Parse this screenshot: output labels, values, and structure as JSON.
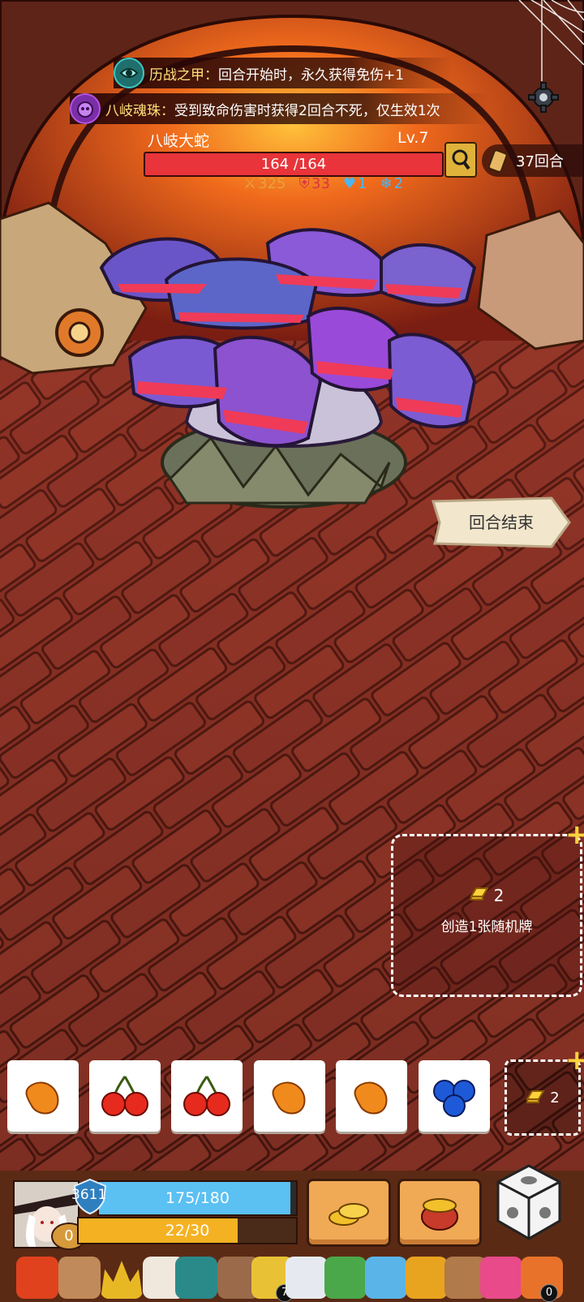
{
  "buffs": [
    {
      "name": "历战之甲：",
      "desc": "回合开始时，永久获得免伤+1",
      "icon": "armor-eye-icon",
      "color": "#3fc7c2"
    },
    {
      "name": "八岐魂珠：",
      "desc": "受到致命伤害时获得2回合不死，仅生效1次",
      "icon": "soul-orb-icon",
      "color": "#b454e0"
    }
  ],
  "boss": {
    "name": "八岐大蛇",
    "level": "Lv.7",
    "hp_text": "164 /164",
    "hp_fraction": 1.0
  },
  "boss_stats": [
    {
      "icon": "attack-icon",
      "value": "325",
      "color": "#e9a13a"
    },
    {
      "icon": "shield-icon",
      "value": "33",
      "color": "#d9363e"
    },
    {
      "icon": "heart-icon",
      "value": "1",
      "color": "#4bb6f0"
    },
    {
      "icon": "snowflake-icon",
      "value": "2",
      "color": "#4bb6f0"
    }
  ],
  "turn": {
    "label": "37回合",
    "icon": "scroll-icon"
  },
  "end_turn": "回合结束",
  "create_card": {
    "cost": "2",
    "label": "创造1张随机牌"
  },
  "hand": [
    {
      "icon": "mango-icon"
    },
    {
      "icon": "cherry-icon"
    },
    {
      "icon": "cherry-icon"
    },
    {
      "icon": "mango-icon"
    },
    {
      "icon": "mango-icon"
    },
    {
      "icon": "blueberry-icon"
    }
  ],
  "small_create_cost": "2",
  "player": {
    "armor": "3611",
    "hp_text": "175/180",
    "hp_fraction": 0.972,
    "energy_text": "22/30",
    "energy_fraction": 0.733,
    "gold": "0"
  },
  "relic_badges": {
    "r7": "7",
    "r14": "0"
  },
  "colors": {
    "hp_blue": "#5bc0f2",
    "boss_red": "#e8343a",
    "energy": "#f4b223",
    "accent_gold": "#ffd23c"
  }
}
